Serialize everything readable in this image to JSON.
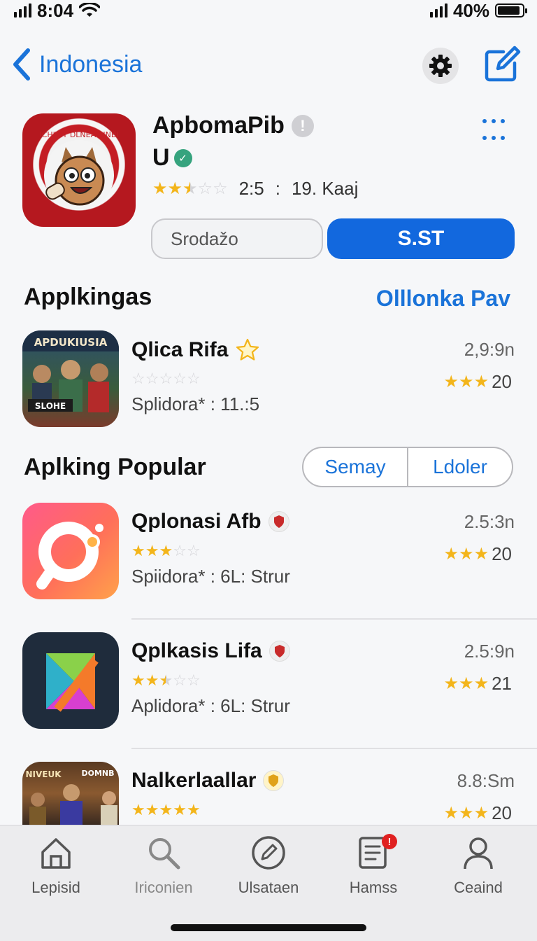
{
  "status_bar": {
    "time": "8:04",
    "battery": "40%",
    "battery_level": 0.9
  },
  "nav": {
    "back_label": "Indonesia",
    "back_icon": "chevron-left-icon",
    "settings_icon": "gear-icon",
    "compose_icon": "compose-icon"
  },
  "featured_app": {
    "title": "ApbomaPib",
    "subtitle": "U",
    "rating_stars": 2.5,
    "rating_text": "2:5",
    "separator": ":",
    "review_count": "19. Kaaj",
    "secondary_button": "Srodažo",
    "primary_button": "S.ST",
    "icon_text": "ICHIVIY DLNEAISINBI"
  },
  "section_applikingas": {
    "title": "Applkingas",
    "link": "Olllonka Pav",
    "items": [
      {
        "name": "Qlica Rifa",
        "stars": 0,
        "subtitle": "Splidora* : 11.:5",
        "size": "2,9:9n",
        "score": "20",
        "score_stars": 3,
        "icon_text": "APDUKIUSIA",
        "icon_caption": "SLOHE"
      }
    ]
  },
  "section_popular": {
    "title": "Aplking Popular",
    "segments": [
      "Semay",
      "Ldoler"
    ],
    "items": [
      {
        "name": "Qplonasi Afb",
        "stars": 3,
        "subtitle": "Spiidora* : 6L: Strur",
        "size": "2.5:3n",
        "score": "20",
        "score_stars": 3
      },
      {
        "name": "Qplkasis Lifa",
        "stars": 2.5,
        "subtitle": "Aplidora* : 6L: Strur",
        "size": "2.5:9n",
        "score": "21",
        "score_stars": 3
      },
      {
        "name": "Nalkerlaallar",
        "stars": 5,
        "subtitle": "",
        "size": "8.8:Sm",
        "score": "20",
        "score_stars": 3,
        "icon_text": "NIVEUK",
        "icon_text_2": "DOMNB"
      }
    ]
  },
  "tab_bar": {
    "tabs": [
      {
        "label": "Lepisid",
        "icon": "home-icon"
      },
      {
        "label": "Iriconien",
        "icon": "search-icon"
      },
      {
        "label": "Ulsataen",
        "icon": "pencil-icon"
      },
      {
        "label": "Hamss",
        "icon": "list-icon",
        "badge": "!"
      },
      {
        "label": "Ceaind",
        "icon": "person-icon"
      }
    ]
  },
  "colors": {
    "accent": "#1a73d9",
    "primary_button": "#1268de",
    "star": "#f3b51b",
    "badge_red": "#e02020"
  }
}
